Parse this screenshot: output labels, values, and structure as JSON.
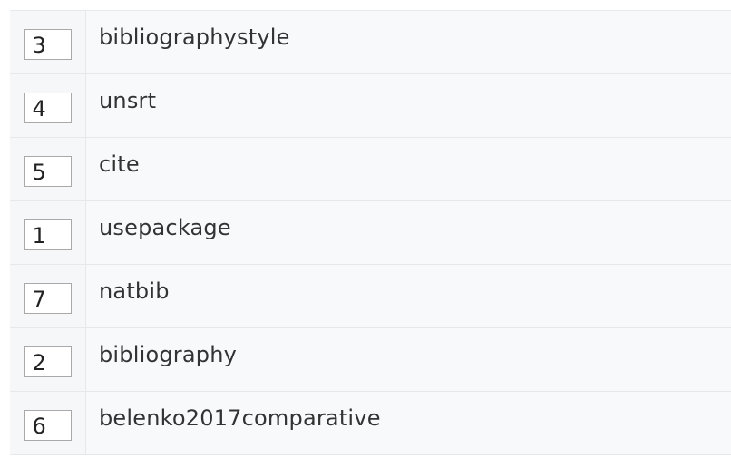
{
  "rows": [
    {
      "number": "3",
      "keyword": "bibliographystyle"
    },
    {
      "number": "4",
      "keyword": "unsrt"
    },
    {
      "number": "5",
      "keyword": "cite"
    },
    {
      "number": "1",
      "keyword": "usepackage"
    },
    {
      "number": "7",
      "keyword": "natbib"
    },
    {
      "number": "2",
      "keyword": "bibliography"
    },
    {
      "number": "6",
      "keyword": "belenko2017comparative"
    }
  ]
}
